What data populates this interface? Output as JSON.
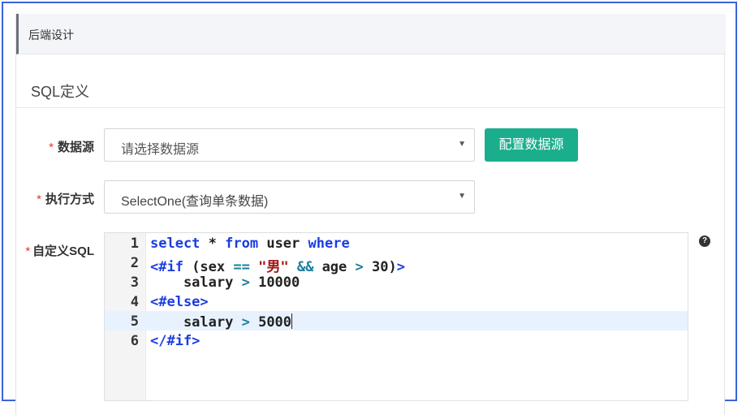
{
  "header": {
    "title": "后端设计"
  },
  "section": {
    "title": "SQL定义"
  },
  "form": {
    "required_mark": "*",
    "datasource": {
      "label": "数据源",
      "placeholder": "请选择数据源",
      "caret": "▼"
    },
    "configure_button": "配置数据源",
    "exec_mode": {
      "label": "执行方式",
      "value": "SelectOne(查询单条数据)",
      "caret": "▼"
    },
    "custom_sql": {
      "label": "自定义SQL",
      "help_icon": "question-circle-icon",
      "help_glyph": "?",
      "active_line": 5,
      "lines": [
        {
          "no": "1",
          "text": "select * from user where"
        },
        {
          "no": "2",
          "text": "<#if (sex == \"男\" && age > 30)>"
        },
        {
          "no": "3",
          "text": "    salary > 10000"
        },
        {
          "no": "4",
          "text": "<#else>"
        },
        {
          "no": "5",
          "text": "    salary > 5000"
        },
        {
          "no": "6",
          "text": "</#if>"
        }
      ]
    }
  },
  "colors": {
    "primary": "#1aae8c",
    "required": "#e0362b",
    "keyword": "#1a3de0",
    "string": "#a31515",
    "frame": "#3a64d8"
  }
}
